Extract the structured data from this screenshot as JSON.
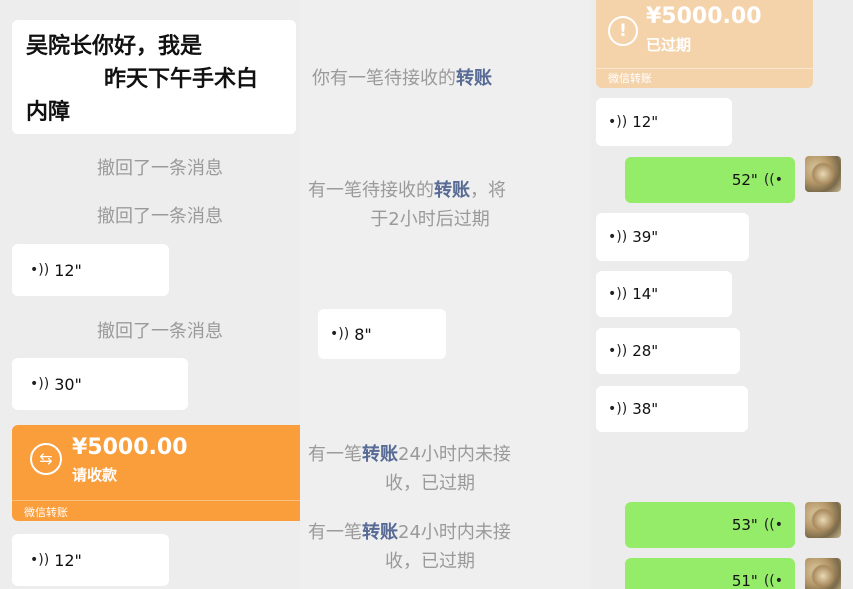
{
  "left": {
    "greeting": "吴院长你好，我是",
    "greeting_line2": "昨天下午手术白",
    "greeting_line3": "内障",
    "recalled1": "撤回了一条消息",
    "recalled2": "撤回了一条消息",
    "voice1": "12\"",
    "recalled3": "撤回了一条消息",
    "voice2": "30\"",
    "transfer": {
      "amount": "¥5000.00",
      "status": "请收款",
      "footer": "微信转账"
    },
    "voice3": "12\""
  },
  "middle": {
    "notice1_pre": "你有一笔待接收的",
    "notice1_hl": "转账",
    "notice2_pre": "有一笔待接收的",
    "notice2_hl": "转账",
    "notice2_post": "，将",
    "notice2_line2": "于2小时后过期",
    "voice": "8\"",
    "notice3_pre": "有一笔",
    "notice3_hl": "转账",
    "notice3_post": "24小时内未接",
    "notice3_line2": "收，已过期",
    "notice4_pre": "有一笔",
    "notice4_hl": "转账",
    "notice4_post": "24小时内未接",
    "notice4_line2": "收，已过期"
  },
  "right": {
    "transfer": {
      "amount": "¥5000.00",
      "status": "已过期",
      "footer": "微信转账"
    },
    "voices_in": [
      "12\"",
      "39\"",
      "14\"",
      "28\"",
      "38\""
    ],
    "voices_out": [
      "52\"",
      "53\"",
      "51\""
    ]
  },
  "icons": {
    "voice_in": "voice-wave-icon",
    "voice_out": "voice-wave-out-icon",
    "transfer": "transfer-arrows-icon",
    "expired": "alert-circle-icon"
  },
  "colors": {
    "bg": "#ededed",
    "bubble_out": "#95ec69",
    "transfer_active": "#fa9d3b",
    "transfer_expired": "#f4d3ab",
    "link": "#576b95"
  }
}
